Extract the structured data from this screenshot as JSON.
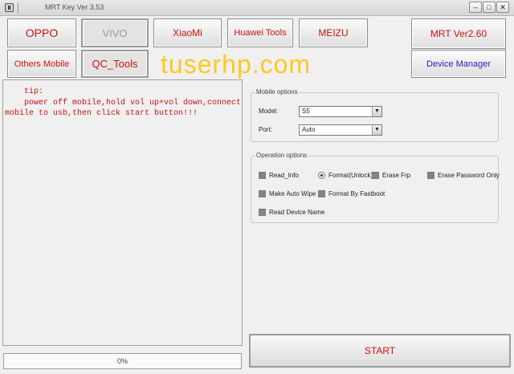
{
  "window": {
    "title": "MRT Key Ver 3.53",
    "minimize": "–",
    "maximize": "□",
    "close": "✕"
  },
  "brands": {
    "oppo": "OPPO",
    "vivo": "VIVO",
    "xiaomi": "XiaoMi",
    "huawei": "Huawei Tools",
    "meizu": "MEIZU",
    "others": "Others Mobile",
    "qc": "QC_Tools"
  },
  "right_buttons": {
    "version": "MRT Ver2.60",
    "device_manager": "Device Manager"
  },
  "watermark": "tuserhp.com",
  "tip": "    tip:\n    power off mobile,hold vol up+vol down,connect\nmobile to usb,then click start button!!!",
  "progress": {
    "value": 0,
    "label": "0%"
  },
  "mobile_options": {
    "legend": "Mobile options",
    "model_label": "Model:",
    "model_value": "S5",
    "port_label": "Port:",
    "port_value": "Auto"
  },
  "operation_options": {
    "legend": "Operation options",
    "read_info": "Read_Info",
    "format_unlock": "Format(Unlock)",
    "erase_frp": "Erase Frp",
    "erase_password": "Erase Password Only",
    "make_auto_wipe": "Make Auto Wipe",
    "format_fastboot": "Format By Fastboot",
    "read_device_name": "Read Device Name",
    "selected": "Format(Unlock)"
  },
  "start_label": "START",
  "colors": {
    "red": "#cc1111",
    "blue": "#2222bb",
    "watermark": "#ffc81e"
  }
}
